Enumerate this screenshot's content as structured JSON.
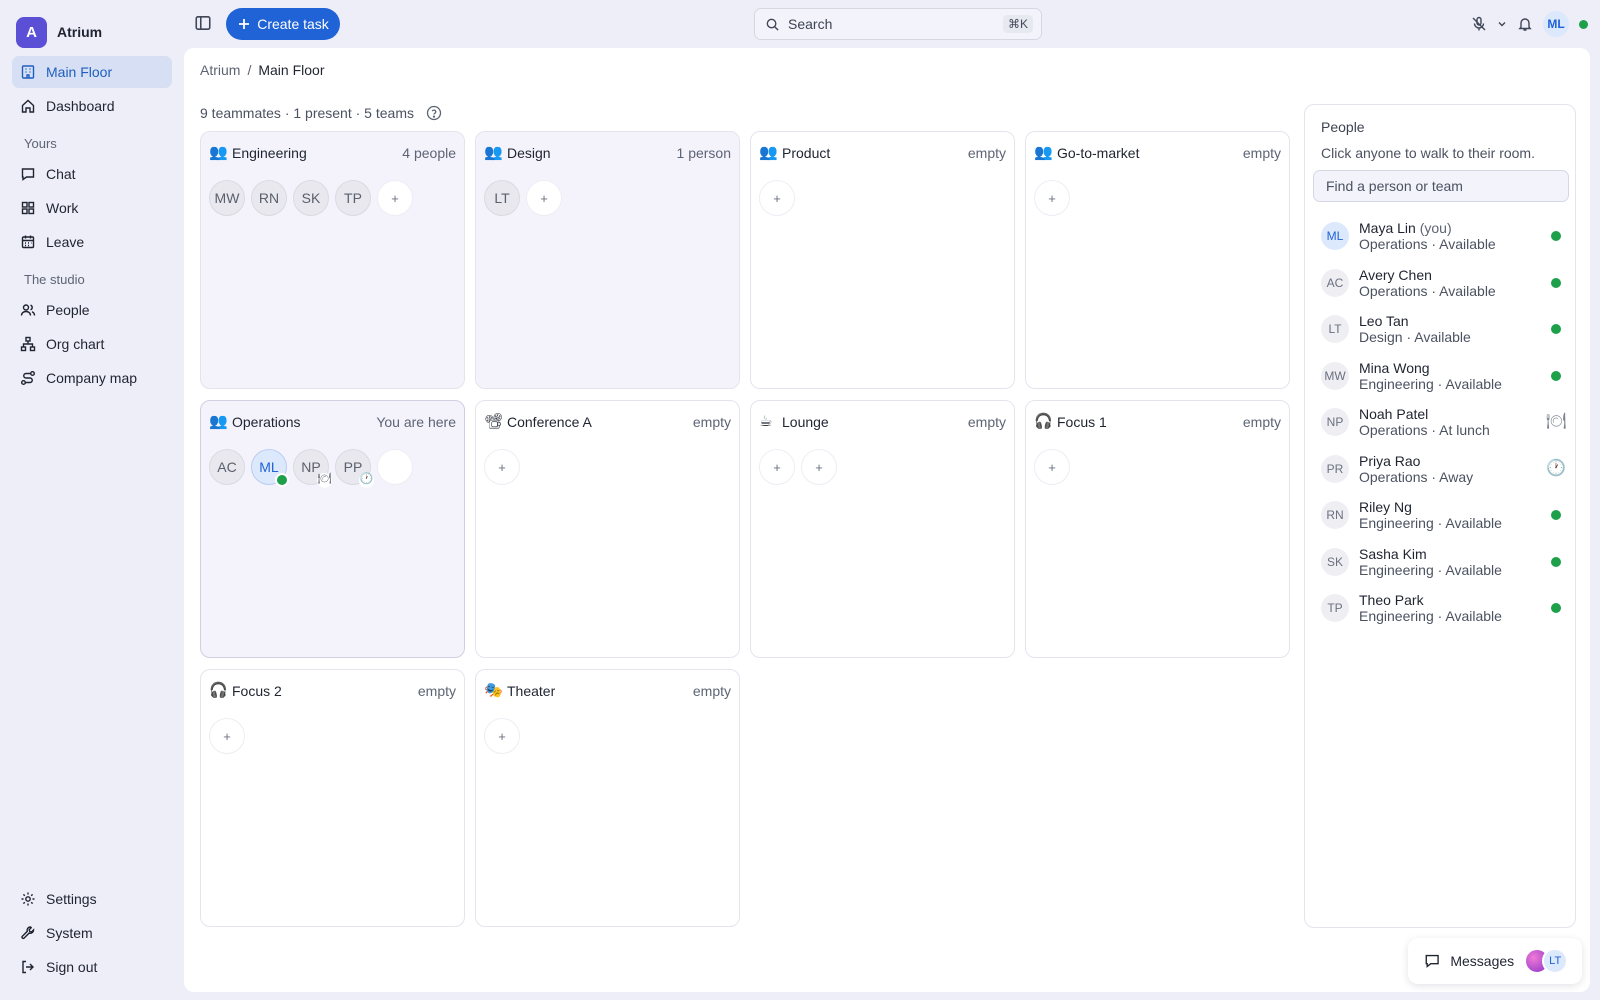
{
  "brand": {
    "logo_letter": "A",
    "name": "Atrium"
  },
  "nav": {
    "primary": [
      {
        "label": "Main Floor",
        "icon": "building-icon",
        "active": true
      },
      {
        "label": "Dashboard",
        "icon": "home-icon"
      }
    ],
    "yours_title": "Yours",
    "yours": [
      {
        "label": "Chat",
        "icon": "chat-icon"
      },
      {
        "label": "Work",
        "icon": "grid-icon"
      },
      {
        "label": "Leave",
        "icon": "calendar-icon"
      }
    ],
    "studio_title": "The studio",
    "studio": [
      {
        "label": "People",
        "icon": "people-icon"
      },
      {
        "label": "Org chart",
        "icon": "org-chart-icon"
      },
      {
        "label": "Company map",
        "icon": "map-route-icon"
      }
    ],
    "bottom": [
      {
        "label": "Settings",
        "icon": "gear-icon"
      },
      {
        "label": "System",
        "icon": "wrench-icon"
      },
      {
        "label": "Sign out",
        "icon": "sign-out-icon"
      }
    ]
  },
  "topbar": {
    "create_label": "Create task",
    "search_label": "Search",
    "search_shortcut": "⌘K",
    "avatar_initials": "ML"
  },
  "breadcrumb": {
    "root": "Atrium",
    "separator": "/",
    "current": "Main Floor"
  },
  "summary": "9 teammates · 1 present · 5 teams",
  "rooms": [
    {
      "name": "Engineering",
      "icon": "👥",
      "status": "4 people",
      "seats": [
        "MW",
        "RN",
        "SK",
        "TP"
      ],
      "add_count": 1
    },
    {
      "name": "Design",
      "icon": "👥",
      "status": "1 person",
      "seats": [
        "LT"
      ],
      "add_count": 1
    },
    {
      "name": "Product",
      "icon": "👥",
      "status": "empty",
      "seats": [],
      "add_count": 1
    },
    {
      "name": "Go-to-market",
      "icon": "👥",
      "status": "empty",
      "seats": [],
      "add_count": 1
    },
    {
      "name": "Operations",
      "icon": "👥",
      "status": "You are here",
      "seats": [
        "AC",
        "ML",
        "NP",
        "PP"
      ],
      "add_count": 0
    },
    {
      "name": "Conference A",
      "icon": "📽",
      "status": "empty",
      "seats": [],
      "add_count": 1
    },
    {
      "name": "Lounge",
      "icon": "☕",
      "status": "empty",
      "seats": [],
      "add_count": 2
    },
    {
      "name": "Focus 1",
      "icon": "🎧",
      "status": "empty",
      "seats": [],
      "add_count": 1
    },
    {
      "name": "Focus 2",
      "icon": "🎧",
      "status": "empty",
      "seats": [],
      "add_count": 1
    },
    {
      "name": "Theater",
      "icon": "🎭",
      "status": "empty",
      "seats": [],
      "add_count": 1
    }
  ],
  "add_seat_label": "+",
  "people_panel": {
    "title": "People",
    "subtitle": "Click anyone to walk to their room.",
    "search_placeholder": "Find a person or team",
    "you_suffix": "(you)",
    "people": [
      {
        "initials": "ML",
        "name": "Maya Lin",
        "you": true,
        "detail": "Operations · Available",
        "status": "available"
      },
      {
        "initials": "AC",
        "name": "Avery Chen",
        "detail": "Operations · Available",
        "status": "available"
      },
      {
        "initials": "LT",
        "name": "Leo Tan",
        "detail": "Design · Available",
        "status": "available"
      },
      {
        "initials": "MW",
        "name": "Mina Wong",
        "detail": "Engineering · Available",
        "status": "available"
      },
      {
        "initials": "NP",
        "name": "Noah Patel",
        "detail": "Operations · At lunch",
        "status": "lunch",
        "status_icon": "🍽"
      },
      {
        "initials": "PR",
        "name": "Priya Rao",
        "detail": "Operations · Away",
        "status": "away",
        "status_icon": "🕐"
      },
      {
        "initials": "RN",
        "name": "Riley Ng",
        "detail": "Engineering · Available",
        "status": "available"
      },
      {
        "initials": "SK",
        "name": "Sasha Kim",
        "detail": "Engineering · Available",
        "status": "available"
      },
      {
        "initials": "TP",
        "name": "Theo Park",
        "detail": "Engineering · Available",
        "status": "available"
      }
    ]
  },
  "messages": {
    "label": "Messages",
    "avatar_initials": "LT"
  },
  "colors": {
    "accent": "#1f63d6",
    "brand": "#5b4fd6",
    "available": "#1ea04b",
    "here_tint": "#f4f3fc"
  }
}
